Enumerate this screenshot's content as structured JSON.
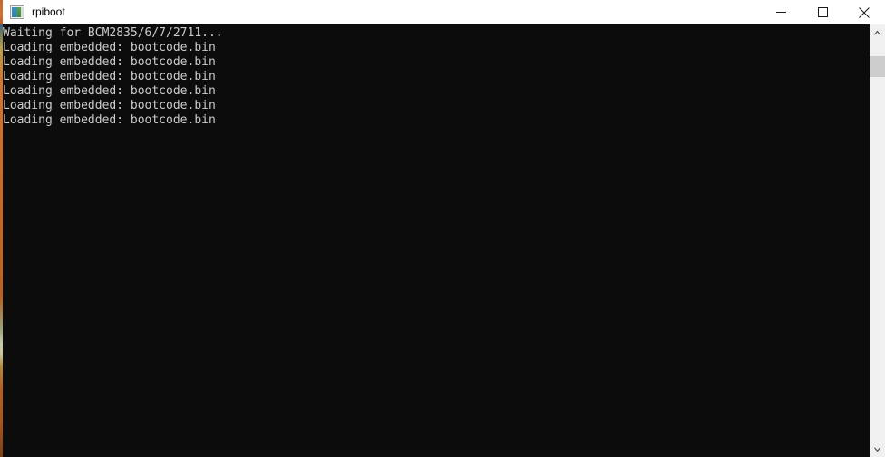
{
  "window": {
    "title": "rpiboot",
    "app_icon": "console-window-icon"
  },
  "titlebar": {
    "minimize_label": "Minimize",
    "maximize_label": "Maximize",
    "close_label": "Close"
  },
  "terminal": {
    "background_color": "#0c0c0c",
    "text_color": "#cccccc",
    "lines": [
      "Waiting for BCM2835/6/7/2711...",
      "Loading embedded: bootcode.bin",
      "Loading embedded: bootcode.bin",
      "Loading embedded: bootcode.bin",
      "Loading embedded: bootcode.bin",
      "Loading embedded: bootcode.bin",
      "Loading embedded: bootcode.bin"
    ]
  },
  "scrollbar": {
    "up_arrow": "chevron-up-icon",
    "down_arrow": "chevron-down-icon",
    "thumb_label": "scrollbar-thumb"
  },
  "accent_colors": {
    "left_strip_orange": "#d4782c",
    "title_border": "#c5682a"
  }
}
